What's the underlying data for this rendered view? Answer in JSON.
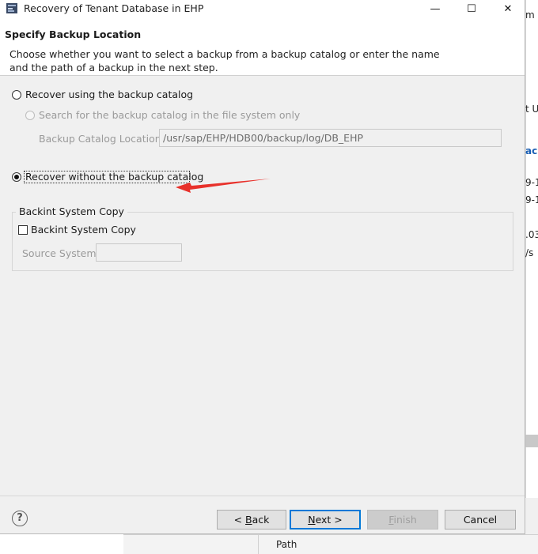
{
  "window": {
    "title": "Recovery of Tenant Database in EHP",
    "minimize_glyph": "—",
    "maximize_glyph": "☐",
    "close_glyph": "✕"
  },
  "header": {
    "page_title": "Specify Backup Location",
    "description": "Choose whether you want to select a backup from a backup catalog or enter the name and the path of a backup in the next step."
  },
  "options": {
    "use_catalog_label": "Recover using the backup catalog",
    "use_catalog_selected": false,
    "search_fs_label": "Search for the backup catalog in the file system only",
    "search_fs_enabled": false,
    "catalog_location_label": "Backup Catalog Location:",
    "catalog_location_value": "/usr/sap/EHP/HDB00/backup/log/DB_EHP",
    "without_catalog_label": "Recover without the backup catalog",
    "without_catalog_selected": true
  },
  "backint": {
    "group_title": "Backint System Copy",
    "checkbox_label": "Backint System Copy",
    "checked": false,
    "source_system_label": "Source System:",
    "source_system_value": ""
  },
  "footer": {
    "help_glyph": "?",
    "back_prefix": "< ",
    "back_accel": "B",
    "back_rest": "ack",
    "next_accel": "N",
    "next_rest": "ext >",
    "finish_accel": "F",
    "finish_rest": "inish",
    "cancel_label": "Cancel"
  },
  "background_app": {
    "fragments": [
      "m U",
      "t U",
      "acl",
      "9-1",
      "9-1",
      ".03",
      "/s"
    ],
    "bottom_label": "Path"
  },
  "colors": {
    "annotation_arrow": "#e8312b",
    "dialog_bg": "#f0f0f0",
    "default_button_border": "#0078d7"
  }
}
